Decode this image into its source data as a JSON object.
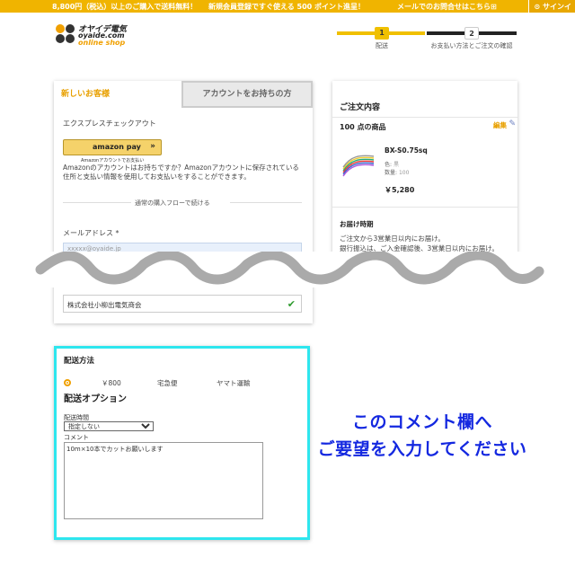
{
  "topbar": {
    "msg1": "8,800円（税込）以上のご購入で送料無料！",
    "msg2": "新規会員登録ですぐ使える 500 ポイント進呈！",
    "msg3": "メールでのお問合せはこちら⊞",
    "signin": "⊙ サインイ"
  },
  "logo": {
    "line1": "オヤイデ電気",
    "line2": "oyaide.com",
    "line3": "online shop"
  },
  "steps": {
    "step1_num": "1",
    "step1_label": "配送",
    "step2_num": "2",
    "step2_label": "お支払い方法とご注文の確認"
  },
  "login": {
    "tab_new": "新しいお客様",
    "tab_account": "アカウントをお持ちの方",
    "express_label": "エクスプレスチェックアウト",
    "amazon_pay_label": "amazon pay",
    "amazon_pay_sub": "Amazonアカウントでお支払い",
    "amazon_text": "Amazonのアカウントはお持ちですか？Amazonアカウントに保存されている住所と支払い情報を使用してお支払いをすることができます。",
    "divider_text": "通常の購入フローで続ける",
    "email_label": "メールアドレス *",
    "email_value": "xxxxx@oyaide.jp",
    "company_value": "株式会社小柳出電気商会"
  },
  "order": {
    "title": "ご注文内容",
    "item_count": "100 点の商品",
    "edit_label": "編集",
    "product_name": "BX-S0.75sq",
    "color_label": "色:",
    "color_value": "黒",
    "qty_label": "数量:",
    "qty_value": "100",
    "price": "￥5,280",
    "delivery_title": "お届け時期",
    "delivery_line1": "ご注文から3営業日以内にお届け。",
    "delivery_line2": "銀行振込は、ご入金確認後、3営業日以内にお届け。"
  },
  "shipping": {
    "method_title": "配送方法",
    "price": "￥800",
    "service": "宅急便",
    "carrier": "ヤマト運輸",
    "options_title": "配送オプション",
    "time_label": "配送時間",
    "time_selected": "指定しない",
    "comment_label": "コメント",
    "comment_value": "10m×10本でカットお願いします"
  },
  "callout": {
    "line1": "このコメント欄へ",
    "line2": "ご要望を入力してください"
  },
  "colors": {
    "brand": "#f0b400",
    "highlight": "#2ee6ee",
    "callout": "#1428e0"
  }
}
